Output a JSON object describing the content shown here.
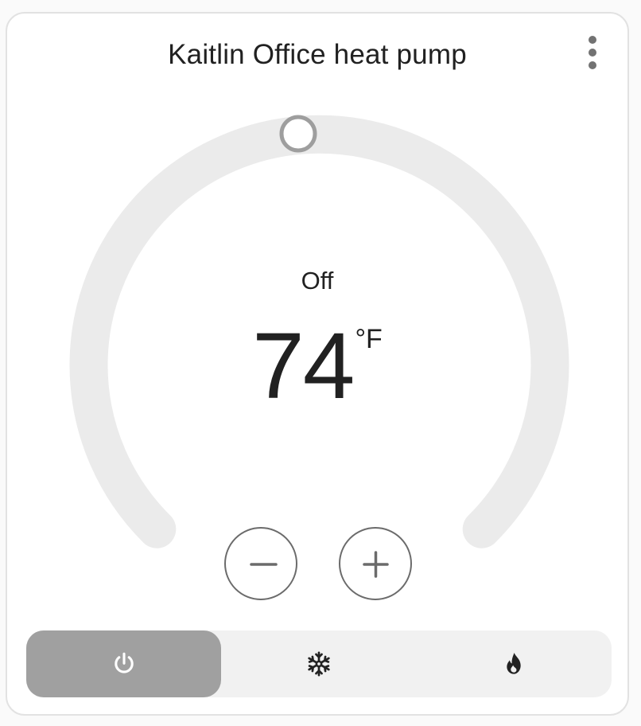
{
  "card": {
    "title": "Kaitlin Office heat pump",
    "menu_icon": "dots-vertical-icon"
  },
  "thermostat": {
    "mode_label": "Off",
    "target_temperature": "74",
    "unit": "°F"
  },
  "controls": {
    "decrease_icon": "minus-icon",
    "increase_icon": "plus-icon"
  },
  "modes": [
    {
      "name": "off",
      "icon": "power-icon",
      "active": true
    },
    {
      "name": "cool",
      "icon": "snowflake-icon",
      "active": false
    },
    {
      "name": "heat",
      "icon": "fire-icon",
      "active": false
    }
  ],
  "colors": {
    "track": "#ebebeb",
    "handle": "#9e9e9e",
    "active_mode": "#a0a0a0",
    "mode_bar": "#f1f1f1"
  }
}
